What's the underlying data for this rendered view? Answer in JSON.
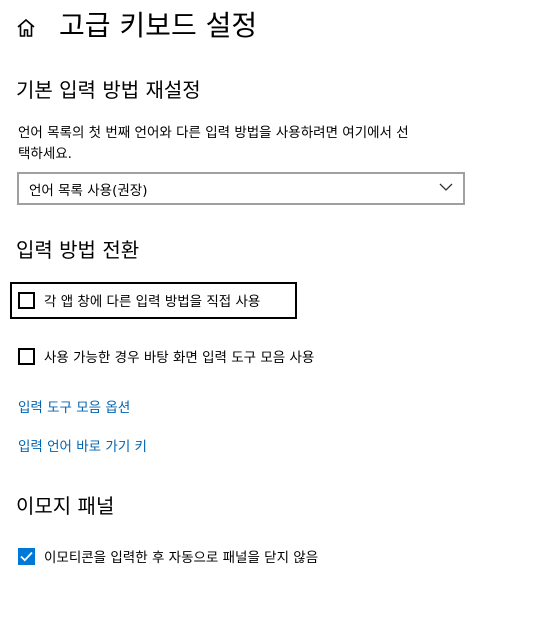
{
  "header": {
    "home_icon": "home-icon",
    "title": "고급 키보드 설정"
  },
  "override_section": {
    "title": "기본 입력 방법 재설정",
    "description_line1": "언어 목록의 첫 번째 언어와 다른 입력 방법을 사용하려면 여기에서 선",
    "description_line2": "택하세요.",
    "dropdown_value": "언어 목록 사용(권장)"
  },
  "switching_section": {
    "title": "입력 방법 전환",
    "per_app_label": "각 앱 창에 다른 입력 방법을 직접 사용",
    "per_app_checked": false,
    "desktop_bar_label": "사용 가능한 경우 바탕 화면 입력 도구 모음 사용",
    "desktop_bar_checked": false,
    "language_bar_options_link": "입력 도구 모음 옵션",
    "hotkeys_link": "입력 언어 바로 가기 키"
  },
  "emoji_section": {
    "title": "이모지 패널",
    "close_panel_label": "이모티콘을 입력한 후 자동으로 패널을 닫지 않음",
    "close_panel_checked": true
  },
  "colors": {
    "accent": "#0078d7",
    "link": "#0063b1"
  }
}
